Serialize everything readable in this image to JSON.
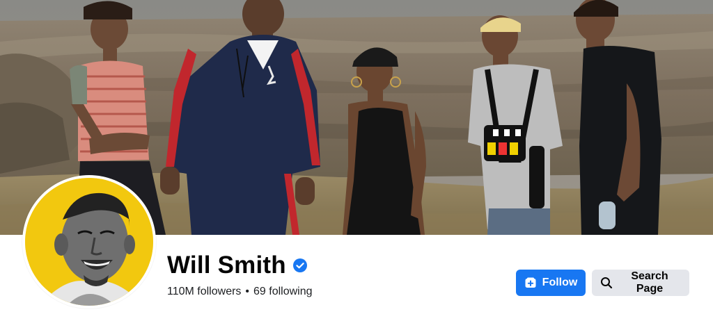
{
  "page": {
    "name": "Will Smith",
    "verified": true,
    "followers": "110M followers",
    "separator": "•",
    "following": "69 following"
  },
  "actions": {
    "follow_label": "Follow",
    "search_label": "Search Page"
  },
  "icons": {
    "verified": "verified-badge-icon",
    "follow": "follow-plus-icon",
    "search": "search-icon"
  },
  "colors": {
    "brand_blue": "#1877f2",
    "secondary_button": "#e4e6eb",
    "avatar_background": "#f2c80f"
  }
}
